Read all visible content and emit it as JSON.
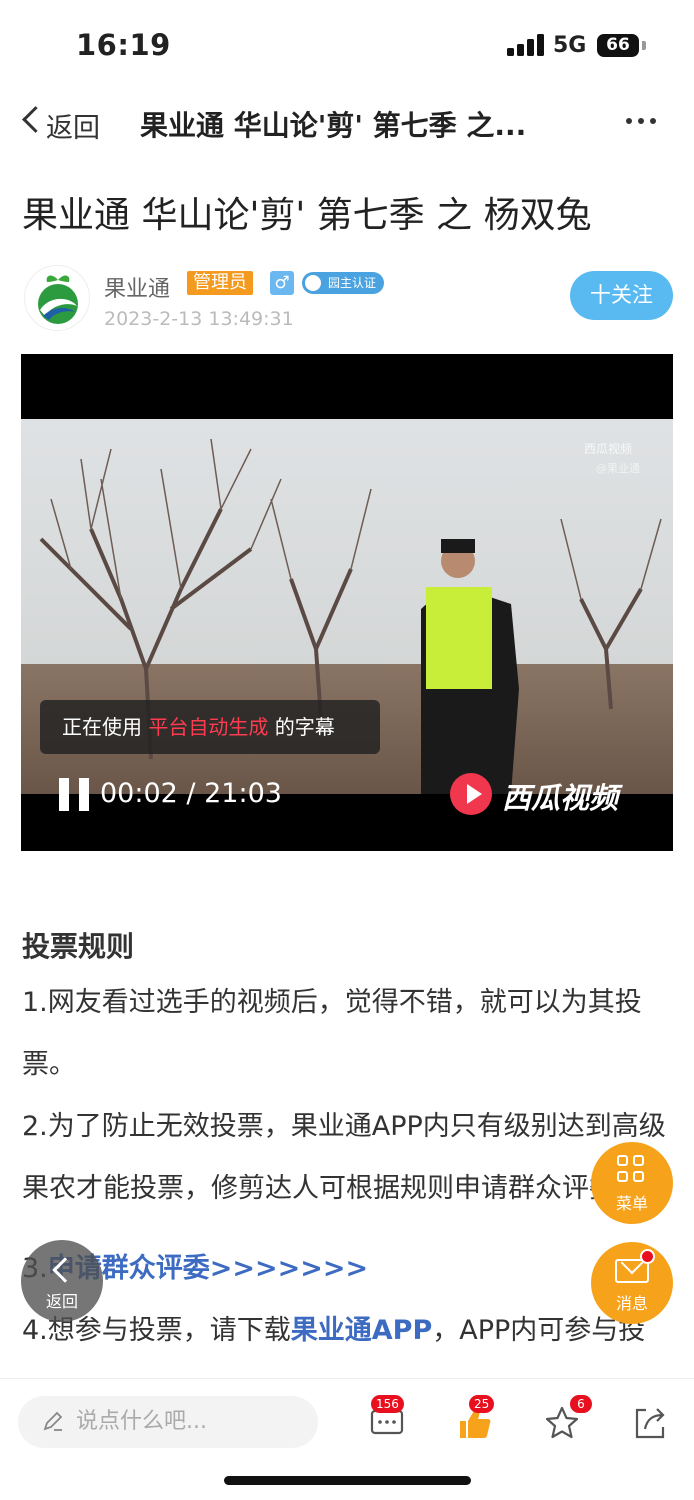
{
  "status": {
    "time": "16:19",
    "network": "5G",
    "battery": "66"
  },
  "nav": {
    "back_label": "返回",
    "title": "果业通 华山论'剪' 第七季 之..."
  },
  "article": {
    "title": "果业通 华山论'剪' 第七季 之 杨双兔",
    "author": "果业通",
    "role_badge": "管理员",
    "gender": "♂",
    "cert_badge": "园主认证",
    "post_time": "2023-2-13 13:49:31",
    "follow_label": "十关注"
  },
  "video": {
    "watermark": "西瓜视频",
    "watermark_sub": "@果业通",
    "subtitle_prefix": "正在使用",
    "subtitle_highlight": "平台自动生成",
    "subtitle_suffix": "的字幕",
    "time_current": "00:02",
    "time_sep": "/",
    "time_total": "21:03",
    "brand": "西瓜视频",
    "progress": 0.0016
  },
  "content": {
    "heading": "投票规则",
    "p1": "1.网友看过选手的视频后，觉得不错，就可以为其投票。",
    "p2": "2.为了防止无效投票，果业通APP内只有级别达到高级果农才能投票，修剪达人可根据规则申请群众评委。",
    "p3_prefix": "3.",
    "p3_link": "申请群众评委>>>>>>>",
    "p4_prefix": "4.想参与投票，请下载",
    "p4_link": "果业通APP",
    "p4_suffix": "，APP内可参与投票"
  },
  "fabs": {
    "menu_label": "菜单",
    "message_label": "消息",
    "back_label": "返回"
  },
  "bottombar": {
    "input_placeholder": "说点什么吧...",
    "comment_count": "156",
    "like_count": "25",
    "favorite_count": "6"
  }
}
